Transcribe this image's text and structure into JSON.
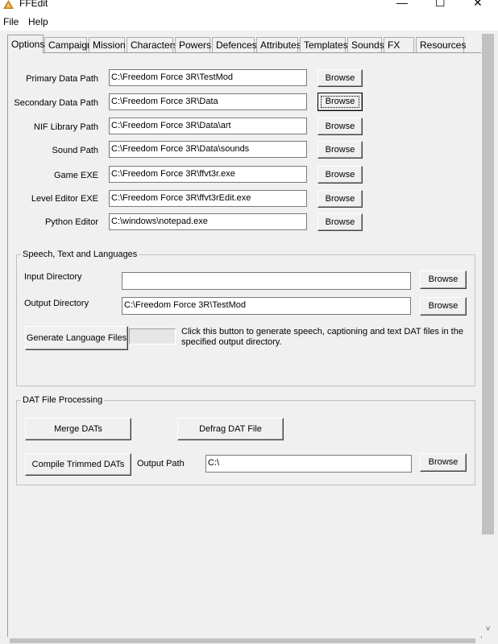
{
  "window": {
    "title": "FFEdit",
    "minimize": "—",
    "maximize": "☐",
    "close": "✕"
  },
  "menu": [
    "File",
    "Help"
  ],
  "tabs": [
    "Options",
    "Campaign",
    "Mission",
    "Characters",
    "Powers",
    "Defences",
    "Attributes",
    "Templates",
    "Sounds",
    "FX",
    "Resources"
  ],
  "paths": [
    {
      "label": "Primary Data Path",
      "value": "C:\\Freedom Force 3R\\TestMod",
      "button": "Browse"
    },
    {
      "label": "Secondary Data Path",
      "value": "C:\\Freedom Force 3R\\Data",
      "button": "Browse"
    },
    {
      "label": "NIF Library Path",
      "value": "C:\\Freedom Force 3R\\Data\\art",
      "button": "Browse"
    },
    {
      "label": "Sound Path",
      "value": "C:\\Freedom Force 3R\\Data\\sounds",
      "button": "Browse"
    },
    {
      "label": "Game EXE",
      "value": "C:\\Freedom Force 3R\\ffvt3r.exe",
      "button": "Browse"
    },
    {
      "label": "Level Editor EXE",
      "value": "C:\\Freedom Force 3R\\ffvt3rEdit.exe",
      "button": "Browse"
    },
    {
      "label": "Python Editor",
      "value": "C:\\windows\\notepad.exe",
      "button": "Browse"
    }
  ],
  "speech": {
    "title": "Speech, Text and Languages",
    "input_label": "Input Directory",
    "input_value": "",
    "input_button": "Browse",
    "output_label": "Output Directory",
    "output_value": "C:\\Freedom Force 3R\\TestMod",
    "output_button": "Browse",
    "generate_button": "Generate Language Files",
    "note": "Click this button to generate speech, captioning and text DAT files in the specified output directory."
  },
  "dat": {
    "title": "DAT File Processing",
    "merge_button": "Merge DATs",
    "defrag_button": "Defrag DAT File",
    "compile_button": "Compile Trimmed DATs",
    "output_label": "Output Path",
    "output_value": "C:\\",
    "output_button": "Browse"
  },
  "scroll": {
    "up": "˄",
    "down": "˅",
    "left": "<",
    "right": ">"
  }
}
